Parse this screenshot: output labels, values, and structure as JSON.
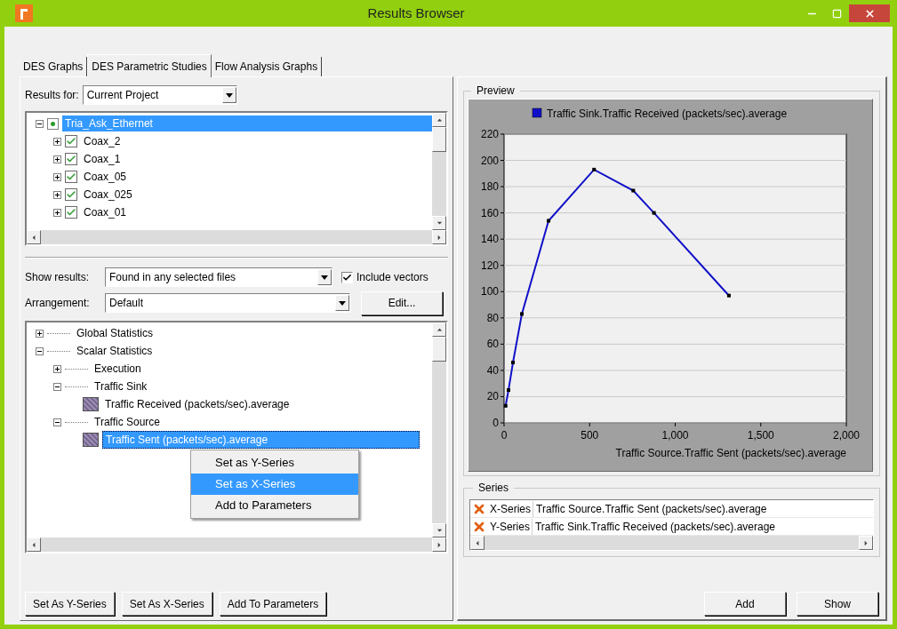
{
  "window": {
    "title": "Results Browser"
  },
  "tabs": [
    {
      "label": "DES Graphs",
      "selected": false
    },
    {
      "label": "DES Parametric Studies",
      "selected": true
    },
    {
      "label": "Flow Analysis Graphs",
      "selected": false
    }
  ],
  "results_for": {
    "label": "Results for:",
    "value": "Current Project"
  },
  "file_tree": [
    {
      "label": "Tria_Ask_Ethernet",
      "kind": "project",
      "selected": true,
      "expanded": true,
      "children": [
        {
          "label": "Coax_2",
          "kind": "file",
          "checked": true,
          "expanded": false,
          "selected": false
        },
        {
          "label": "Coax_1",
          "kind": "file",
          "checked": true,
          "expanded": false,
          "selected": false
        },
        {
          "label": "Coax_05",
          "kind": "file",
          "checked": true,
          "expanded": false,
          "selected": false
        },
        {
          "label": "Coax_025",
          "kind": "file",
          "checked": true,
          "expanded": false,
          "selected": false
        },
        {
          "label": "Coax_01",
          "kind": "file",
          "checked": true,
          "expanded": false,
          "selected": false
        }
      ]
    }
  ],
  "show_results": {
    "label": "Show results:",
    "value": "Found in any selected files"
  },
  "include_vectors": {
    "label": "Include vectors",
    "checked": true
  },
  "arrangement": {
    "label": "Arrangement:",
    "value": "Default"
  },
  "edit_button": "Edit...",
  "stats_tree": [
    {
      "label": "Global Statistics",
      "kind": "folder",
      "expanded": false,
      "selected": false
    },
    {
      "label": "Scalar Statistics",
      "kind": "folder",
      "expanded": true,
      "selected": false,
      "children": [
        {
          "label": "Execution",
          "kind": "folder",
          "expanded": false,
          "selected": false
        },
        {
          "label": "Traffic Sink",
          "kind": "folder",
          "expanded": true,
          "selected": false,
          "children": [
            {
              "label": "Traffic Received (packets/sec).average",
              "kind": "statistic",
              "selected": false
            }
          ]
        },
        {
          "label": "Traffic Source",
          "kind": "folder",
          "expanded": true,
          "selected": false,
          "children": [
            {
              "label": "Traffic Sent (packets/sec).average",
              "kind": "statistic",
              "selected": true
            }
          ]
        }
      ]
    }
  ],
  "context_menu": [
    {
      "label": "Set as Y-Series",
      "selected": false
    },
    {
      "label": "Set as X-Series",
      "selected": true
    },
    {
      "label": "Add to Parameters",
      "selected": false
    }
  ],
  "left_buttons": [
    "Set As Y-Series",
    "Set As X-Series",
    "Add To Parameters"
  ],
  "preview": {
    "title": "Preview",
    "chart_data": {
      "type": "line",
      "xlabel": "Traffic Source.Traffic Sent (packets/sec).average",
      "x": [
        9,
        26,
        52,
        104,
        260,
        526,
        755,
        876,
        1314
      ],
      "series": [
        {
          "name": "Traffic Sink.Traffic Received (packets/sec).average",
          "color": "#1010c8",
          "marker": "square",
          "values": [
            13,
            25,
            46,
            83,
            154,
            193,
            177,
            160,
            97
          ]
        }
      ],
      "xlim": [
        0,
        2000
      ],
      "ylim": [
        0,
        220
      ],
      "xticks": [
        {
          "value": 0,
          "label": "0"
        },
        {
          "value": 500,
          "label": "500"
        },
        {
          "value": 1000,
          "label": "1,000"
        },
        {
          "value": 1500,
          "label": "1,500"
        },
        {
          "value": 2000,
          "label": "2,000"
        }
      ],
      "yticks": [
        0,
        20,
        40,
        60,
        80,
        100,
        120,
        140,
        160,
        180,
        200,
        220
      ],
      "grid": true
    }
  },
  "series_panel": {
    "title": "Series",
    "rows": [
      {
        "type": "X-Series",
        "name": "Traffic Source.Traffic Sent (packets/sec).average"
      },
      {
        "type": "Y-Series",
        "name": "Traffic Sink.Traffic Received (packets/sec).average"
      }
    ]
  },
  "bottom_buttons": [
    "Add",
    "Show"
  ]
}
